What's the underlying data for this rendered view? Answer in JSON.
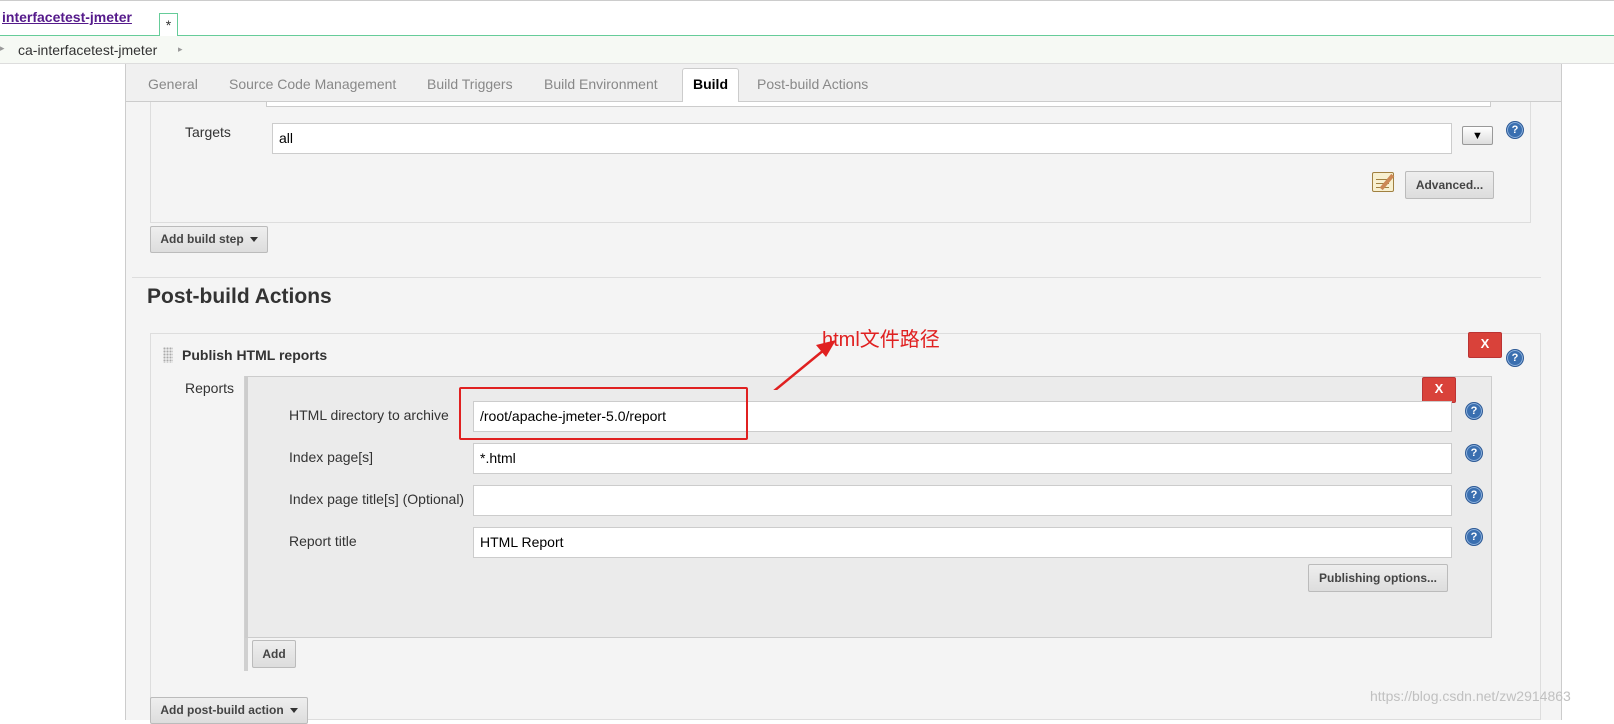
{
  "header": {
    "job_name": "interfacetest-jmeter",
    "tab_marker": "*"
  },
  "breadcrumb": {
    "item": "ca-interfacetest-jmeter"
  },
  "tabs": [
    {
      "label": "General"
    },
    {
      "label": "Source Code Management"
    },
    {
      "label": "Build Triggers"
    },
    {
      "label": "Build Environment"
    },
    {
      "label": "Build",
      "active": true
    },
    {
      "label": "Post-build Actions"
    }
  ],
  "build_step": {
    "targets_label": "Targets",
    "targets_value": "all",
    "dropdown_glyph": "▼",
    "advanced_label": "Advanced...",
    "add_build_step_label": "Add build step"
  },
  "post_build": {
    "heading": "Post-build Actions",
    "publish_title": "Publish HTML reports",
    "delete_label": "X",
    "reports_label": "Reports",
    "fields": [
      {
        "label": "HTML directory to archive",
        "value": "/root/apache-jmeter-5.0/report"
      },
      {
        "label": "Index page[s]",
        "value": "*.html"
      },
      {
        "label": "Index page title[s] (Optional)",
        "value": ""
      },
      {
        "label": "Report title",
        "value": "HTML Report"
      }
    ],
    "publishing_options_label": "Publishing options...",
    "add_label": "Add",
    "add_post_build_action_label": "Add post-build action"
  },
  "annotation": {
    "text": "html文件路径",
    "color": "#e02020"
  },
  "help_glyph": "?",
  "watermark": "https://blog.csdn.net/zw2914863",
  "colors": {
    "accent_green": "#66cc99",
    "delete_red": "#d9423a",
    "help_blue": "#3a6fb0"
  }
}
